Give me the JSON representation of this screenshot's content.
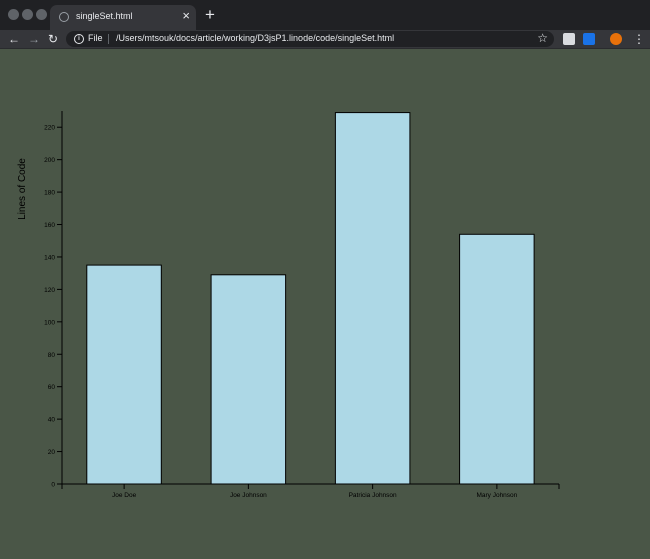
{
  "browser": {
    "tab_title": "singleSet.html",
    "close_label": "×",
    "new_tab_label": "+",
    "back_label": "←",
    "forward_label": "→",
    "reload_label": "↻",
    "info_label": "i",
    "file_label": "File",
    "url": "/Users/mtsouk/docs/article/working/D3jsP1.linode/code/singleSet.html",
    "bookmark_label": "☆",
    "menu_label": "⋮"
  },
  "colors": {
    "page_background": "#4a5647",
    "bar_fill": "#add8e6",
    "bar_stroke": "#000000"
  },
  "chart_data": {
    "type": "bar",
    "categories": [
      "Joe Doe",
      "Joe Johnson",
      "Patricia Johnson",
      "Mary Johnson"
    ],
    "values": [
      135,
      129,
      229,
      154
    ],
    "title": "",
    "xlabel": "",
    "ylabel": "Lines of Code",
    "ylim": [
      0,
      230
    ],
    "yticks": [
      0,
      20,
      40,
      60,
      80,
      100,
      120,
      140,
      160,
      180,
      200,
      220
    ],
    "grid": false,
    "legend": "none"
  }
}
